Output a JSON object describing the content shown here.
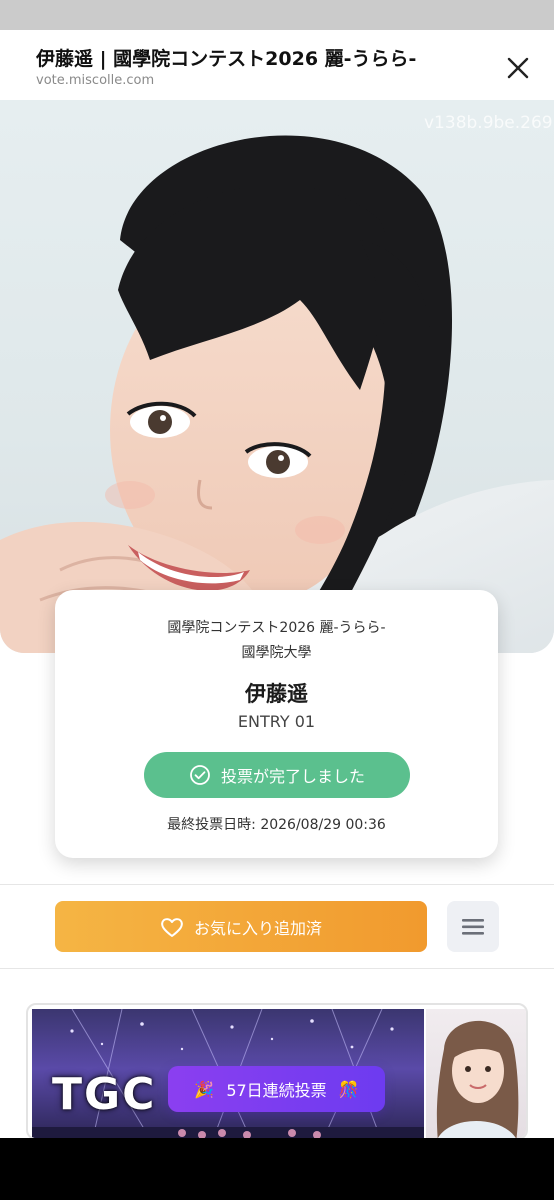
{
  "header": {
    "title": "伊藤遥 | 國學院コンテスト2026 麗-うらら-",
    "url": "vote.miscolle.com"
  },
  "hero": {
    "watermark": "v138b.9be.269"
  },
  "card": {
    "contest": "國學院コンテスト2026 麗-うらら-",
    "university": "國學院大學",
    "name": "伊藤遥",
    "entry": "ENTRY 01",
    "vote_status": "投票が完了しました",
    "last_vote": "最終投票日時: 2026/08/29 00:36"
  },
  "actions": {
    "favorite_label": "お気に入り追加済"
  },
  "banner": {
    "streak_label": "57日連続投票",
    "streak_emoji_left": "🎉",
    "streak_emoji_right": "🎊",
    "banner_text": "TGC"
  },
  "colors": {
    "vote_green": "#5bc08e",
    "favorite_orange": "#f19a2e",
    "streak_purple": "#7b3ff0"
  }
}
